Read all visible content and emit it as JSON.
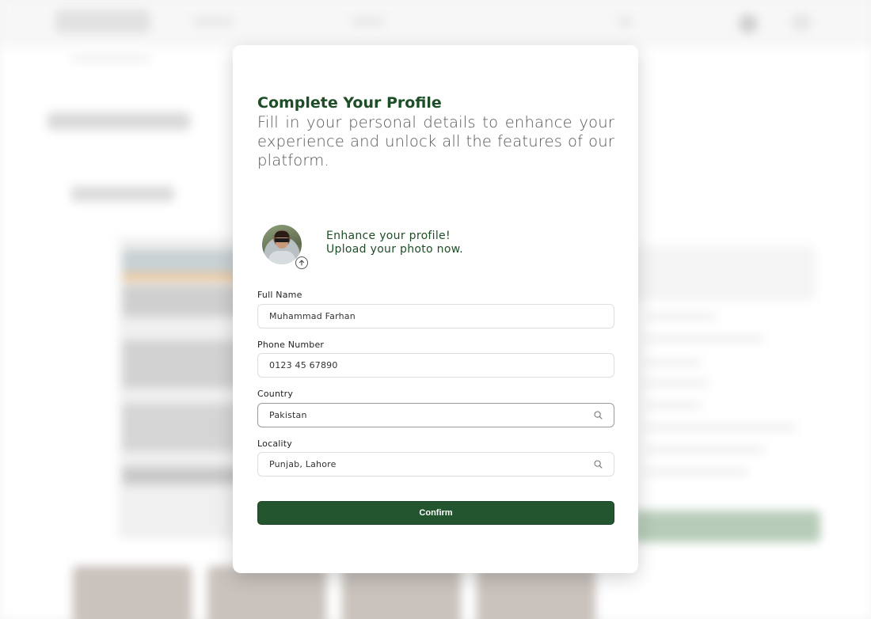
{
  "modal": {
    "title": "Complete Your Profile",
    "description": "Fill in your personal details to enhance your experience and unlock all the features of our platform.",
    "enhance_line1": "Enhance your profile!",
    "enhance_line2": "Upload your photo now.",
    "avatar_icon": "user-photo",
    "upload_icon": "upload-arrow-icon"
  },
  "form": {
    "full_name": {
      "label": "Full Name",
      "value": "Muhammad Farhan"
    },
    "phone": {
      "label": "Phone Number",
      "value": "0123 45 67890"
    },
    "country": {
      "label": "Country",
      "value": "Pakistan",
      "icon": "search-icon"
    },
    "locality": {
      "label": "Locality",
      "value": "Punjab, Lahore",
      "icon": "search-icon"
    },
    "confirm_label": "Confirm"
  },
  "colors": {
    "primary_green": "#23562f",
    "title_green": "#1e4d27"
  }
}
